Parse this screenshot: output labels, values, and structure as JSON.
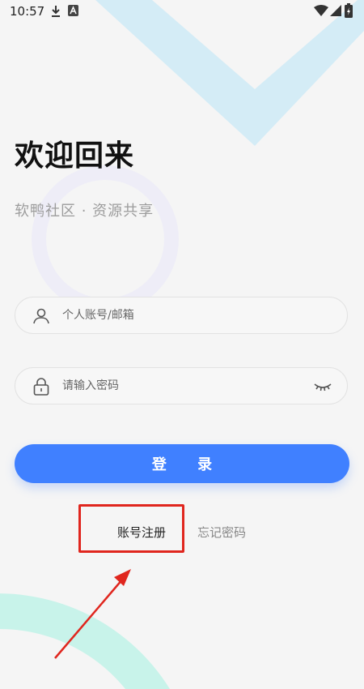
{
  "status_bar": {
    "time": "10:57",
    "left_icons": [
      "download-icon",
      "a-box-icon"
    ],
    "right_icons": [
      "wifi-icon",
      "signal-icon",
      "battery-icon"
    ]
  },
  "welcome_title": "欢迎回来",
  "subtitle": "软鸭社区 · 资源共享",
  "account_field": {
    "placeholder": "个人账号/邮箱",
    "value": "",
    "icon": "user-icon"
  },
  "password_field": {
    "placeholder": "请输入密码",
    "value": "",
    "icon": "lock-icon",
    "toggle_icon": "eye-closed-icon"
  },
  "login_button_label": "登 录",
  "register_link": "账号注册",
  "forgot_link": "忘记密码",
  "colors": {
    "primary": "#4080ff",
    "highlight_box": "#e0261e",
    "bg_v_shape": "#d4ecf6",
    "bg_arc": "#c8f3ea"
  }
}
